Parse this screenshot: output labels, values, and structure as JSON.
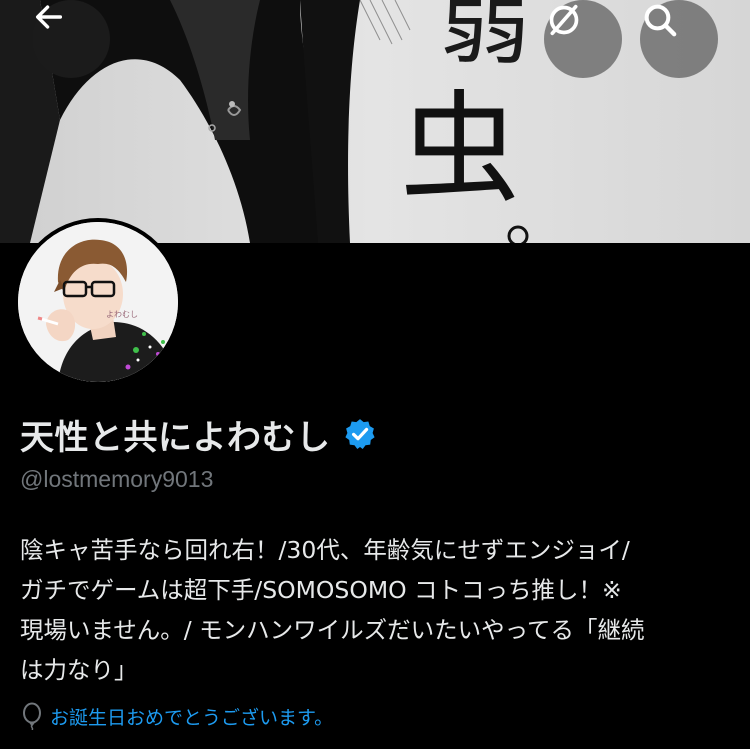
{
  "header": {
    "back_icon": "arrow-left-icon",
    "hide_icon": "eye-slash-icon",
    "search_icon": "search-icon"
  },
  "banner": {
    "text_chars": [
      "弱",
      "虫"
    ]
  },
  "profile": {
    "display_name": "天性と共によわむし",
    "verified": true,
    "verified_color": "#1d9bf0",
    "handle": "@lostmemory9013",
    "bio": "陰キャ苦手なら回れ右！/30代、年齢気にせずエンジョイ/\nガチでゲームは超下手/SOMOSOMO コトコっち推し！※\n現場いません。/ モンハンワイルズだいたいやってる「継続\nは力なり」",
    "birthday_icon": "balloon-icon",
    "birthday_text": "お誕生日おめでとうございます。"
  }
}
